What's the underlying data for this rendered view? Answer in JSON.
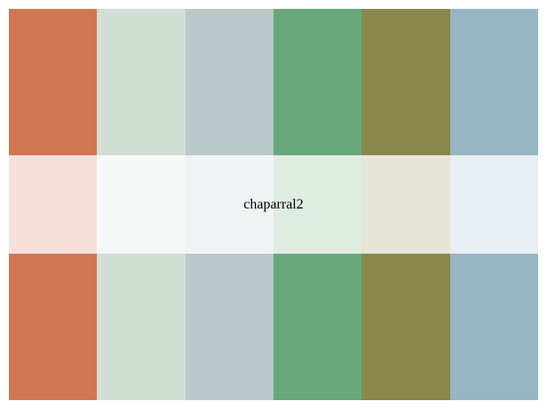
{
  "palette": {
    "name": "chaparral2",
    "colors": [
      "#D07752",
      "#D2DED4",
      "#BAC8CA",
      "#68A77B",
      "#89874D",
      "#98B5C4"
    ]
  }
}
